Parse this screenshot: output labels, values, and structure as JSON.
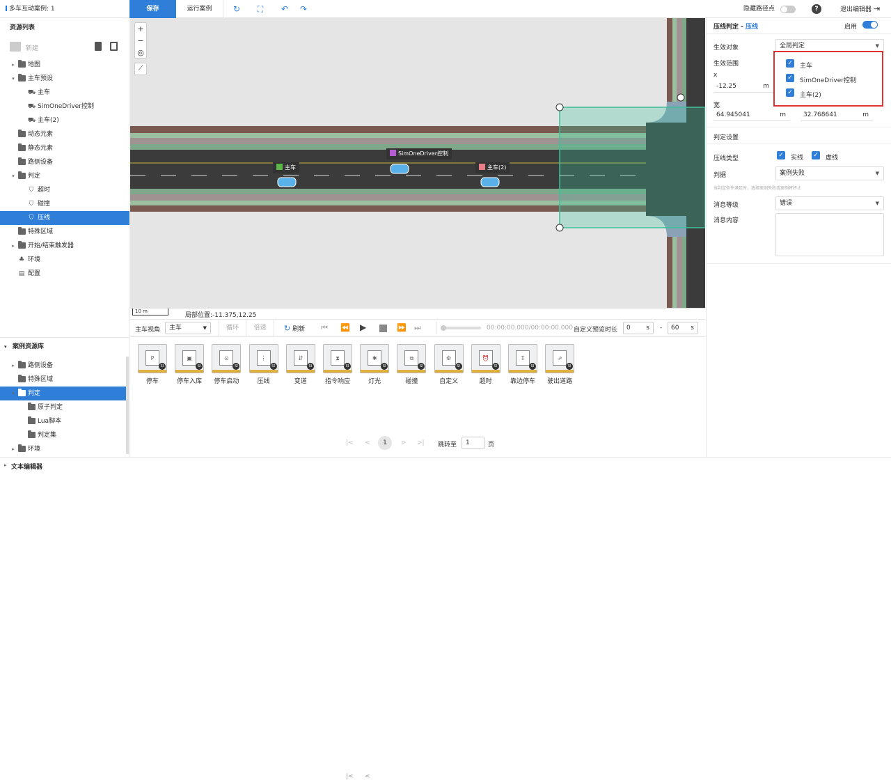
{
  "app": {
    "title": "多车互动案例: 1",
    "save_label": "保存",
    "run_label": "运行案例",
    "hide_path_label": "隐藏路径点",
    "help_label": "?",
    "exit_label": "退出编辑器"
  },
  "resources": {
    "header": "资源列表",
    "new_label": "新建",
    "items": [
      {
        "label": "地图",
        "expanded": false,
        "level": 0,
        "icon": "folder-icon"
      },
      {
        "label": "主车预设",
        "expanded": true,
        "level": 0,
        "icon": "folder-open-icon"
      },
      {
        "label": "主车",
        "level": 1,
        "icon": "vehicle-icon"
      },
      {
        "label": "SimOneDriver控制",
        "level": 1,
        "icon": "vehicle-icon"
      },
      {
        "label": "主车(2)",
        "level": 1,
        "icon": "vehicle-icon"
      },
      {
        "label": "动态元素",
        "level": 0,
        "icon": "folder-icon"
      },
      {
        "label": "静态元素",
        "level": 0,
        "icon": "folder-icon"
      },
      {
        "label": "路侧设备",
        "level": 0,
        "icon": "folder-icon"
      },
      {
        "label": "判定",
        "expanded": true,
        "level": 0,
        "icon": "folder-open-icon"
      },
      {
        "label": "超时",
        "level": 1,
        "icon": "shield-icon"
      },
      {
        "label": "碰撞",
        "level": 1,
        "icon": "shield-icon"
      },
      {
        "label": "压线",
        "level": 1,
        "icon": "shield-icon",
        "selected": true
      },
      {
        "label": "特殊区域",
        "level": 0,
        "icon": "folder-icon"
      },
      {
        "label": "开始/结束触发器",
        "expanded": false,
        "level": 0,
        "icon": "folder-icon"
      },
      {
        "label": "环境",
        "level": 0,
        "icon": "environment-icon"
      },
      {
        "label": "配置",
        "level": 0,
        "icon": "config-icon"
      }
    ]
  },
  "case_library": {
    "header": "案例资源库",
    "items": [
      {
        "label": "路侧设备",
        "level": 0,
        "expanded": false
      },
      {
        "label": "特殊区域",
        "level": 0
      },
      {
        "label": "判定",
        "level": 0,
        "expanded": true,
        "selected": true
      },
      {
        "label": "原子判定",
        "level": 1
      },
      {
        "label": "Lua脚本",
        "level": 1
      },
      {
        "label": "判定集",
        "level": 1
      },
      {
        "label": "环境",
        "level": 0,
        "expanded": false
      }
    ]
  },
  "map": {
    "scale_label": "10 m",
    "position_label": "局部位置:-11.375,12.25",
    "vehicles": [
      {
        "label": "主车",
        "color": "#5bb847"
      },
      {
        "label": "SimOneDriver控制",
        "color": "#b65bd1"
      },
      {
        "label": "主车(2)",
        "color": "#e87f86"
      }
    ]
  },
  "controls": {
    "view_label": "主车视角",
    "view_value": "主车",
    "loop_label": "循环",
    "speed_label": "倍速",
    "refresh_label": "刷新",
    "time": "00:00:00.000/00:00:00.000",
    "preview_label": "自定义预览时长",
    "start_value": "0",
    "start_unit": "s",
    "dash": "-",
    "end_value": "60",
    "end_unit": "s"
  },
  "library": {
    "items": [
      "停车",
      "停车入库",
      "停车启动",
      "压线",
      "变道",
      "指令响应",
      "灯光",
      "碰撞",
      "自定义",
      "超时",
      "靠边停车",
      "驶出道路"
    ],
    "glyphs": [
      "P",
      "▣",
      "⊙",
      "⋮",
      "⇵",
      "⧗",
      "✱",
      "⧉",
      "⚙",
      "⏰",
      "↧",
      "⇗"
    ],
    "badge": "SI",
    "pager": {
      "prev_first": "|<",
      "prev": "<",
      "current": "1",
      "next": ">",
      "next_last": ">|",
      "jump_label": "跳转至",
      "jump_value": "1",
      "page_unit": "页"
    }
  },
  "properties": {
    "header": "压线判定 - ",
    "header_link": "压线",
    "enabled_label": "启用",
    "target_label": "生效对象",
    "target_value": "全局判定",
    "range_label": "生效范围",
    "x_label": "x",
    "x_value": "-12.25",
    "x_unit": "m",
    "width_label": "宽",
    "width_value": "64.945041",
    "width_unit": "m",
    "height_value": "32.768641",
    "height_unit": "m",
    "judge_settings": "判定设置",
    "line_type_label": "压线类型",
    "solid_label": "实线",
    "dashed_label": "虚线",
    "basis_label": "判据",
    "basis_value": "案例失败",
    "basis_hint": "当判定条件满足时，选择案例失败或案例将终止",
    "level_label": "消息等级",
    "level_value": "错误",
    "message_label": "消息内容",
    "popup_options": [
      "主车",
      "SimOneDriver控制",
      "主车(2)"
    ]
  },
  "bottom": {
    "text_editor_label": "文本编辑器"
  },
  "colors": {
    "accent": "#2f7fd9",
    "road": "#3a3a3a",
    "sidewalk": "#8a7b78",
    "grass": "#8fb89a",
    "zone": "#3fbf9a",
    "popup_border": "#e03030"
  }
}
